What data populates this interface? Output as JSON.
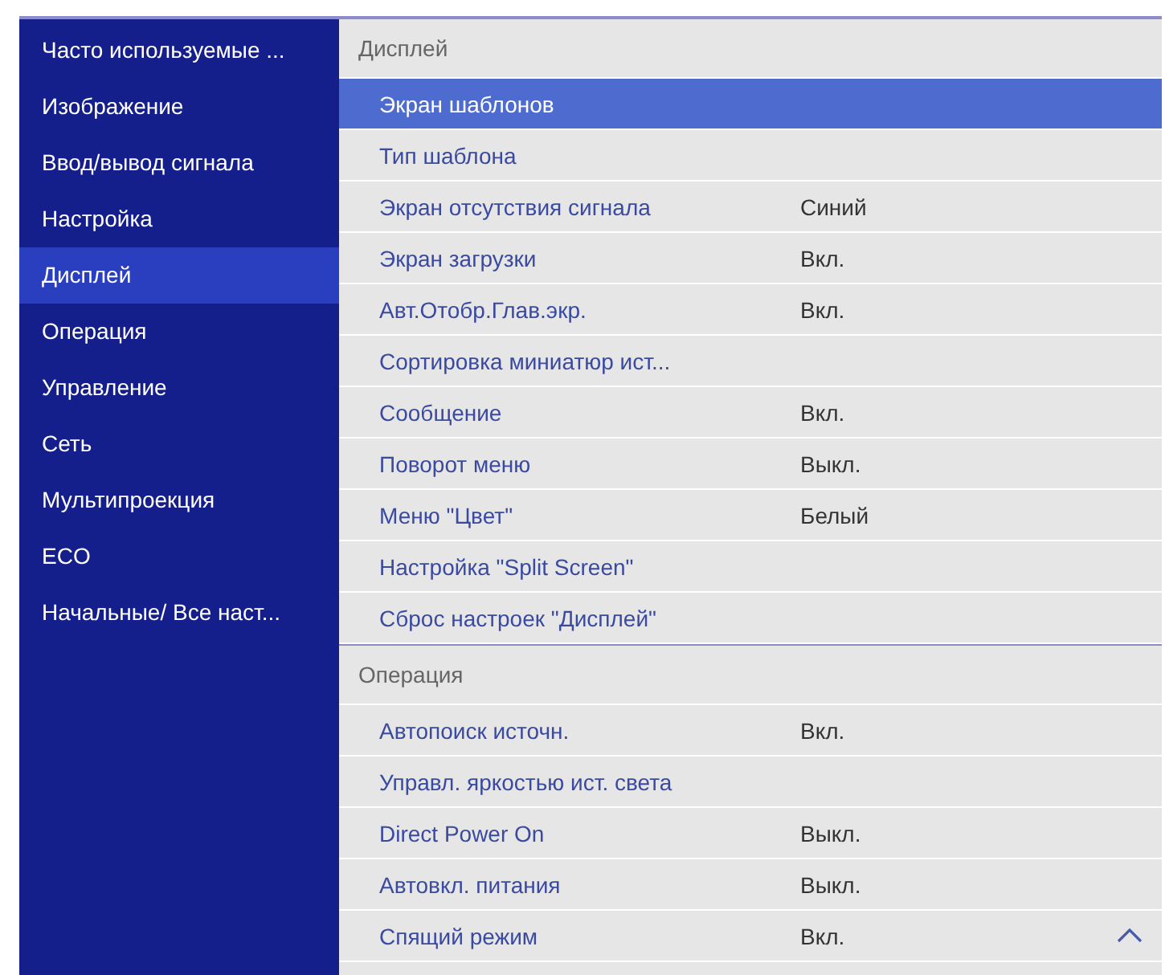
{
  "sidebar": {
    "items": [
      {
        "label": "Часто используемые ...",
        "selected": false
      },
      {
        "label": "Изображение",
        "selected": false
      },
      {
        "label": "Ввод/вывод сигнала",
        "selected": false
      },
      {
        "label": "Настройка",
        "selected": false
      },
      {
        "label": "Дисплей",
        "selected": true
      },
      {
        "label": "Операция",
        "selected": false
      },
      {
        "label": "Управление",
        "selected": false
      },
      {
        "label": "Сеть",
        "selected": false
      },
      {
        "label": "Мультипроекция",
        "selected": false
      },
      {
        "label": "ECO",
        "selected": false
      },
      {
        "label": "Начальные/ Все наст...",
        "selected": false
      }
    ]
  },
  "sections": [
    {
      "title": "Дисплей",
      "rows": [
        {
          "label": "Экран шаблонов",
          "selected": true
        },
        {
          "label": "Тип шаблона",
          "selected": false
        },
        {
          "label": "Экран отсутствия сигнала",
          "value": "Синий",
          "selected": false
        },
        {
          "label": "Экран загрузки",
          "value": "Вкл.",
          "selected": false
        },
        {
          "label": "Авт.Отобр.Глав.экр.",
          "value": "Вкл.",
          "selected": false
        },
        {
          "label": "Сортировка миниатюр ист...",
          "selected": false
        },
        {
          "label": "Сообщение",
          "value": "Вкл.",
          "selected": false
        },
        {
          "label": "Поворот меню",
          "value": "Выкл.",
          "selected": false
        },
        {
          "label": "Меню \"Цвет\"",
          "value": "Белый",
          "selected": false
        },
        {
          "label": "Настройка \"Split Screen\"",
          "selected": false
        },
        {
          "label": "Сброс настроек \"Дисплей\"",
          "selected": false
        }
      ]
    },
    {
      "title": "Операция",
      "rows": [
        {
          "label": "Автопоиск источн.",
          "value": "Вкл.",
          "selected": false
        },
        {
          "label": "Управл. яркостью ист. света",
          "selected": false
        },
        {
          "label": "Direct Power On",
          "value": "Выкл.",
          "selected": false
        },
        {
          "label": "Автовкл. питания",
          "value": "Выкл.",
          "selected": false
        },
        {
          "label": "Спящий режим",
          "value": "Вкл.",
          "selected": false
        }
      ]
    }
  ]
}
